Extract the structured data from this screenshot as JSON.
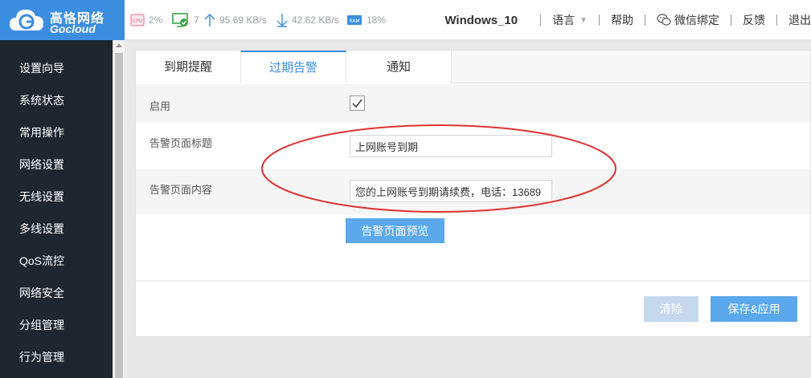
{
  "brand": {
    "name_cn": "高恪网络",
    "name_en": "Gocloud",
    "color": "#3b8de0"
  },
  "status": {
    "cpu_badge": "CPU",
    "cpu": "2%",
    "devices": "7",
    "upload": "95.69 KB/s",
    "download": "42.62 KB/s",
    "ram_badge": "RAM",
    "ram": "18%"
  },
  "nav": {
    "hostname": "Windows_10",
    "language": "语言",
    "help": "帮助",
    "wechat": "微信绑定",
    "feedback": "反馈",
    "logout": "退出"
  },
  "sidebar": {
    "items": [
      "设置向导",
      "系统状态",
      "常用操作",
      "网络设置",
      "无线设置",
      "多线设置",
      "QoS流控",
      "网络安全",
      "分组管理",
      "行为管理"
    ]
  },
  "tabs": [
    {
      "label": "到期提醒",
      "active": false
    },
    {
      "label": "过期告警",
      "active": true
    },
    {
      "label": "通知",
      "active": false
    }
  ],
  "form": {
    "enable_label": "启用",
    "enabled": true,
    "title_label": "告警页面标题",
    "title_value": "上网账号到期",
    "content_label": "告警页面内容",
    "content_value": "您的上网账号到期请续费，电话：13689",
    "preview_button": "告警页面预览"
  },
  "actions": {
    "clear": "清除",
    "save": "保存&应用"
  },
  "colors": {
    "accent": "#5ba8ec",
    "sidebar_bg": "#1e2630",
    "annotation": "#e03030"
  }
}
